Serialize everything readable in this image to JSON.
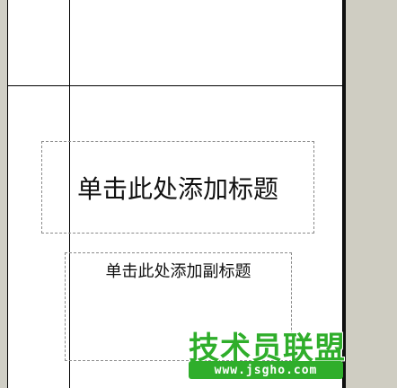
{
  "slide": {
    "title_placeholder": "单击此处添加标题",
    "subtitle_placeholder": "单击此处添加副标题"
  },
  "watermark": {
    "name": "技术员联盟",
    "url": "www.jsgho.com"
  },
  "colors": {
    "workspace": "#d0cfc6",
    "slide_background": "#ffffff",
    "watermark_green": "#2fae2b"
  }
}
